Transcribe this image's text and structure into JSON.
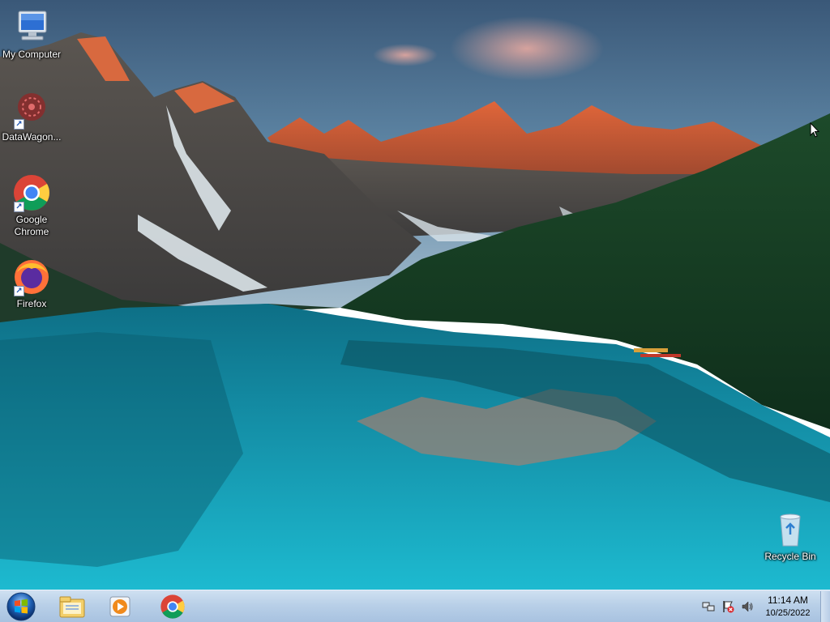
{
  "desktop": {
    "icons": [
      {
        "label": "My Computer"
      },
      {
        "label": "DataWagon..."
      },
      {
        "label": "Google Chrome"
      },
      {
        "label": "Firefox"
      },
      {
        "label": "Recycle Bin"
      }
    ]
  },
  "taskbar": {
    "pinned": [
      {
        "name": "windows-explorer-icon"
      },
      {
        "name": "media-player-icon"
      },
      {
        "name": "chrome-icon"
      }
    ],
    "clock": {
      "time": "11:14 AM",
      "date": "10/25/2022"
    }
  },
  "colors": {
    "taskbar": "#b9d0e8",
    "sky_top": "#3d5f7e",
    "water": "#1aa3b8"
  }
}
